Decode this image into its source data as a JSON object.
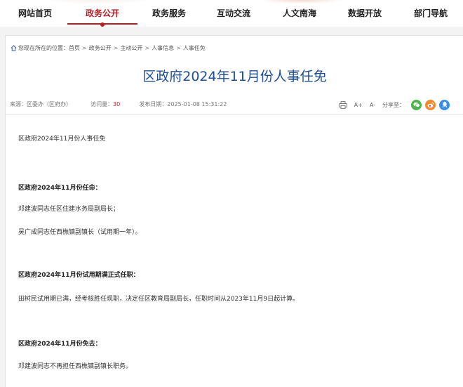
{
  "nav": {
    "items": [
      "网站首页",
      "政务公开",
      "政务服务",
      "互动交流",
      "人文南海",
      "数据开放",
      "部门导航"
    ],
    "active_index": 1
  },
  "breadcrumb": {
    "prefix": "您现在所在的位置：",
    "items": [
      "首页",
      "政务公开",
      "主动公开",
      "人事信息",
      "人事任免"
    ]
  },
  "article": {
    "title": "区政府2024年11月份人事任免",
    "source_label": "来源：",
    "source": "区委办（区府办）",
    "views_label": "访问量：",
    "views": "30",
    "date_label": "发布日期：",
    "date": "2025-01-08 15:31:22",
    "paragraphs": [
      "区政府2024年11月份人事任免",
      "区政府2024年11月份任命：",
      "邓建波同志任区住建水务局副局长；",
      "吴广成同志任西樵镇副镇长（试用期一年）。",
      "区政府2024年11月份试用期满正式任职：",
      "田树民试用期已满，经考核胜任现职，决定任区教育局副局长，任职时间从2023年11月9日起计算。",
      "区政府2024年11月份免去：",
      "邓建波同志不再担任西樵镇副镇长职务。"
    ]
  },
  "tools": {
    "font_increase": "A+",
    "font_decrease": "A-",
    "share_label": "分享至："
  },
  "colors": {
    "accent": "#b81c22",
    "title": "#1f4e93",
    "wechat": "#4db34d",
    "weibo": "#f08c2d",
    "qq": "#3a8ee6"
  }
}
